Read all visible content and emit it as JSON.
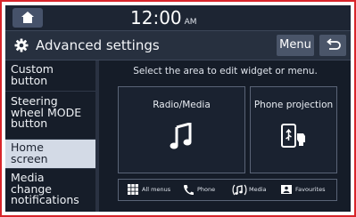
{
  "status_bar": {
    "time": "12:00",
    "ampm": "AM"
  },
  "header": {
    "title": "Advanced settings",
    "menu_label": "Menu"
  },
  "sidebar": {
    "items": [
      {
        "lines": [
          "Custom",
          "button"
        ],
        "active": false
      },
      {
        "lines": [
          "Steering",
          "wheel MODE",
          "button"
        ],
        "active": false
      },
      {
        "lines": [
          "Home",
          "screen"
        ],
        "active": true
      },
      {
        "lines": [
          "Media",
          "change",
          "notifications"
        ],
        "active": false
      }
    ]
  },
  "main": {
    "instruction": "Select the area to edit widget or menu.",
    "tiles": [
      {
        "label": "Radio/Media",
        "icon": "music-note-icon"
      },
      {
        "label": "Phone projection",
        "icon": "phone-projection-icon"
      }
    ],
    "shortcuts": [
      {
        "label": "All menus",
        "icon": "grid-icon"
      },
      {
        "label": "Phone",
        "icon": "phone-icon"
      },
      {
        "label": "Media",
        "icon": "media-icon"
      },
      {
        "label": "Favourites",
        "icon": "favourites-icon"
      }
    ]
  },
  "colors": {
    "frame_border": "#d8252a",
    "background": "#151c28",
    "active_item": "#d3dae6",
    "button": "#4a5569"
  }
}
